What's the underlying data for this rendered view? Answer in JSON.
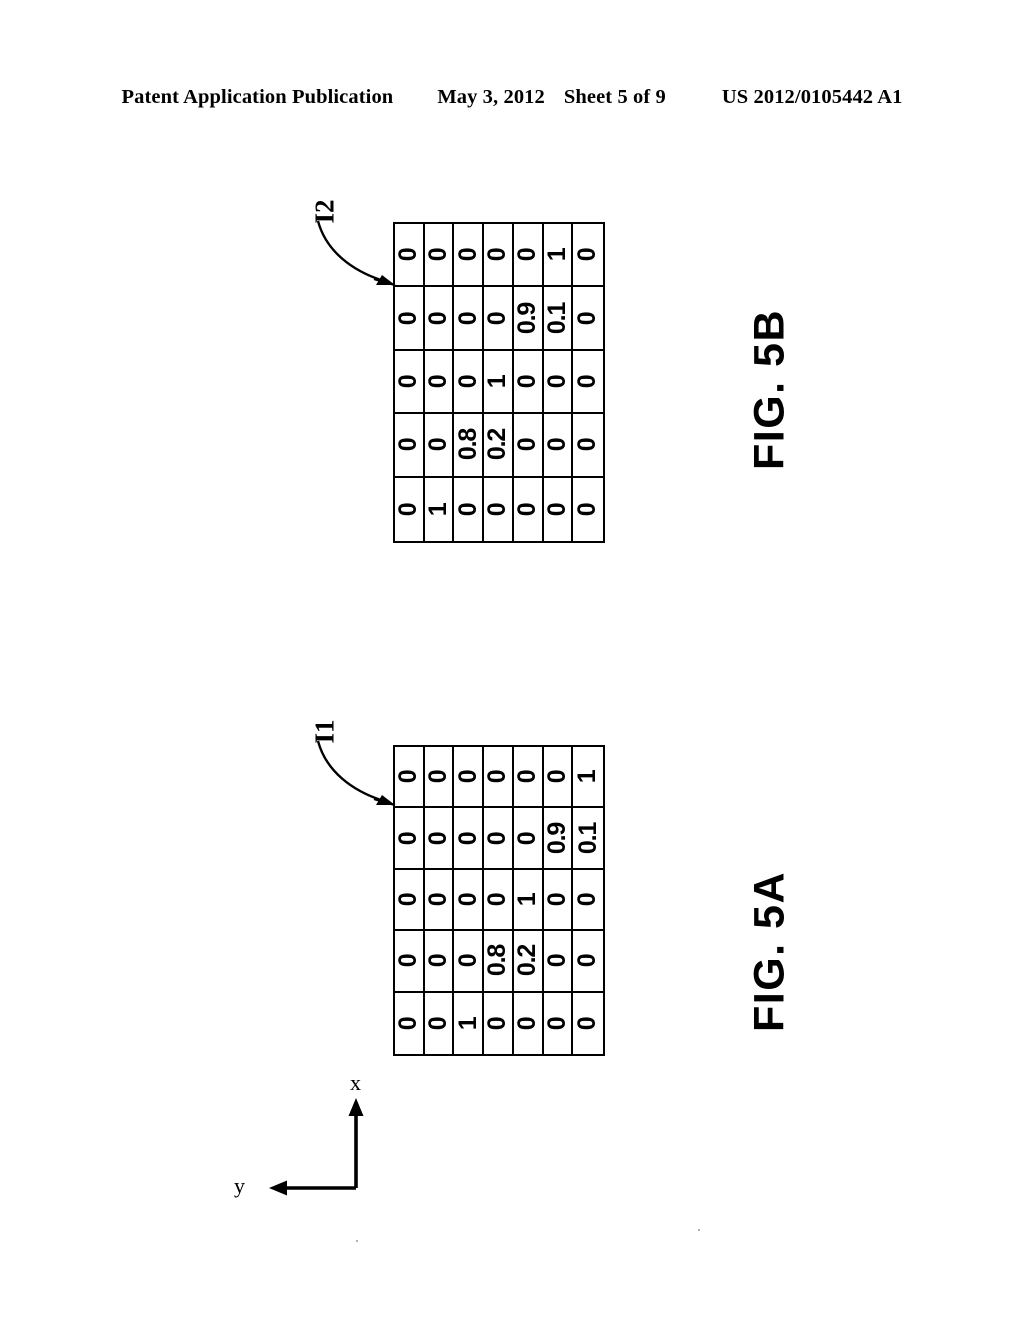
{
  "header": {
    "publication": "Patent Application Publication",
    "date": "May 3, 2012",
    "sheet": "Sheet 5 of 9",
    "number": "US 2012/0105442 A1"
  },
  "figures": [
    {
      "id": "fig-5b",
      "caption": "FIG. 5B",
      "ref_label": "I2",
      "grid": {
        "rows": 5,
        "cols": 7,
        "orientation": "rotated-90",
        "cells": [
          [
            "0",
            "0",
            "0",
            "0",
            "0",
            "1",
            "0"
          ],
          [
            "0",
            "0",
            "0",
            "0",
            "0.9",
            "0.1",
            "0"
          ],
          [
            "0",
            "0",
            "0",
            "1",
            "0",
            "0",
            "0"
          ],
          [
            "0",
            "0",
            "0.8",
            "0.2",
            "0",
            "0",
            "0"
          ],
          [
            "0",
            "1",
            "0",
            "0",
            "0",
            "0",
            "0"
          ]
        ]
      }
    },
    {
      "id": "fig-5a",
      "caption": "FIG. 5A",
      "ref_label": "I1",
      "grid": {
        "rows": 5,
        "cols": 7,
        "orientation": "rotated-90",
        "cells": [
          [
            "0",
            "0",
            "0",
            "0",
            "0",
            "0",
            "1"
          ],
          [
            "0",
            "0",
            "0",
            "0",
            "0",
            "0.9",
            "0.1"
          ],
          [
            "0",
            "0",
            "0",
            "0",
            "1",
            "0",
            "0"
          ],
          [
            "0",
            "0",
            "0",
            "0.8",
            "0.2",
            "0",
            "0"
          ],
          [
            "0",
            "0",
            "1",
            "0",
            "0",
            "0",
            "0"
          ]
        ]
      }
    }
  ],
  "axis_indicator": {
    "x_label": "x",
    "y_label": "y",
    "x_direction": "up",
    "y_direction": "left"
  },
  "colors": {
    "ink": "#000000",
    "paper": "#ffffff"
  }
}
